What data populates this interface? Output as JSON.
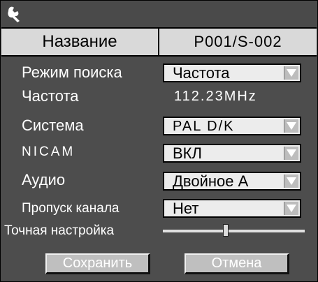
{
  "header": {
    "icon": "wrench-icon"
  },
  "name_row": {
    "label": "Название",
    "value": "P001/S-002"
  },
  "search_mode": {
    "label": "Режим поиска",
    "value": "Частота"
  },
  "frequency": {
    "label": "Частота",
    "value": "112.23MHz"
  },
  "system": {
    "label": "Система",
    "value": "PAL D/K"
  },
  "nicam": {
    "label": "NICAM",
    "value": "ВКЛ"
  },
  "audio": {
    "label": "Аудио",
    "value": "Двойное А"
  },
  "skip_channel": {
    "label": "Пропуск канала",
    "value": "Нет"
  },
  "fine_tune": {
    "label": "Точная настройка"
  },
  "buttons": {
    "save": "Сохранить",
    "cancel": "Отмена"
  },
  "colors": {
    "panel": "#4d4d4d",
    "name_row": "#d9d9d9",
    "select": "#ececec"
  }
}
